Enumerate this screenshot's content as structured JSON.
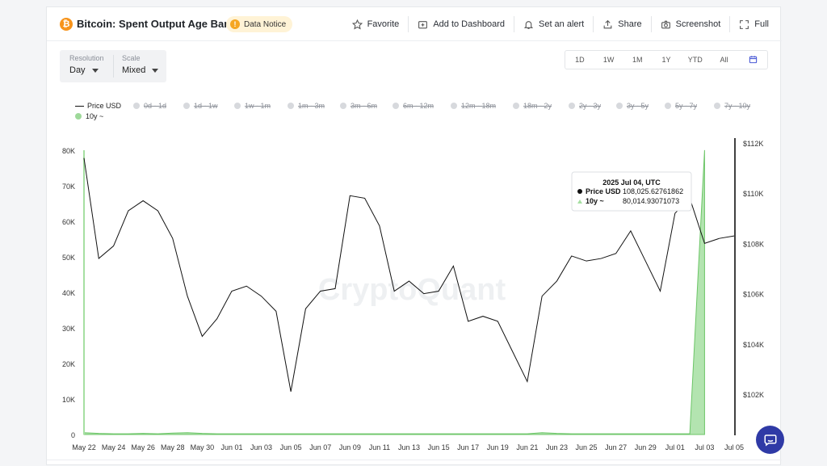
{
  "header": {
    "btc_symbol": "₿",
    "title": "Bitcoin: Spent Output Age Bands",
    "notice": "Data Notice",
    "actions": [
      {
        "label": "Favorite",
        "icon": "star-icon"
      },
      {
        "label": "Add to Dashboard",
        "icon": "dashboard-add-icon"
      },
      {
        "label": "Set an alert",
        "icon": "bell-icon"
      },
      {
        "label": "Share",
        "icon": "share-icon"
      },
      {
        "label": "Screenshot",
        "icon": "camera-icon"
      },
      {
        "label": "Full",
        "icon": "fullscreen-icon"
      }
    ]
  },
  "controls": {
    "resolution_label": "Resolution",
    "resolution_value": "Day",
    "scale_label": "Scale",
    "scale_value": "Mixed",
    "ranges": [
      "1D",
      "1W",
      "1M",
      "1Y",
      "YTD",
      "All"
    ]
  },
  "legend": [
    {
      "label": "Price USD",
      "active": true,
      "kind": "line"
    },
    {
      "label": "0d - 1d",
      "active": false
    },
    {
      "label": "1d - 1w",
      "active": false
    },
    {
      "label": "1w - 1m",
      "active": false
    },
    {
      "label": "1m - 3m",
      "active": false
    },
    {
      "label": "3m - 6m",
      "active": false
    },
    {
      "label": "6m - 12m",
      "active": false
    },
    {
      "label": "12m - 18m",
      "active": false
    },
    {
      "label": "18m - 2y",
      "active": false
    },
    {
      "label": "2y - 3y",
      "active": false
    },
    {
      "label": "3y - 5y",
      "active": false
    },
    {
      "label": "5y - 7y",
      "active": false
    },
    {
      "label": "7y - 10y",
      "active": false
    },
    {
      "label": "10y ~",
      "active": true,
      "kind": "area"
    }
  ],
  "watermark": "CryptoQuant",
  "tooltip": {
    "date": "2025 Jul 04, UTC",
    "price_label": "Price USD",
    "price_value": "108,025.62761862",
    "band_label": "10y ~",
    "band_value": "80,014.93071073"
  },
  "colors": {
    "price_line": "#111111",
    "band_fill": "#a6dfa2",
    "band_stroke": "#6cc567",
    "accent": "#2f3aa6",
    "bitcoin": "#f7931a"
  },
  "chart_data": {
    "type": "line",
    "x": [
      "May 22",
      "May 23",
      "May 24",
      "May 25",
      "May 26",
      "May 27",
      "May 28",
      "May 29",
      "May 30",
      "May 31",
      "Jun 01",
      "Jun 02",
      "Jun 03",
      "Jun 04",
      "Jun 05",
      "Jun 06",
      "Jun 07",
      "Jun 08",
      "Jun 09",
      "Jun 10",
      "Jun 11",
      "Jun 12",
      "Jun 13",
      "Jun 14",
      "Jun 15",
      "Jun 16",
      "Jun 17",
      "Jun 18",
      "Jun 19",
      "Jun 20",
      "Jun 21",
      "Jun 22",
      "Jun 23",
      "Jun 24",
      "Jun 25",
      "Jun 26",
      "Jun 27",
      "Jun 28",
      "Jun 29",
      "Jun 30",
      "Jul 01",
      "Jul 02",
      "Jul 03",
      "Jul 04",
      "Jul 05"
    ],
    "x_tick_labels": [
      "May 22",
      "May 24",
      "May 26",
      "May 28",
      "May 30",
      "Jun 01",
      "Jun 03",
      "Jun 05",
      "Jun 07",
      "Jun 09",
      "Jun 11",
      "Jun 13",
      "Jun 15",
      "Jun 17",
      "Jun 19",
      "Jun 21",
      "Jun 23",
      "Jun 25",
      "Jun 27",
      "Jun 29",
      "Jul 01",
      "Jul 03",
      "Jul 05"
    ],
    "series": [
      {
        "name": "Price USD",
        "axis": "right",
        "values": [
          111400,
          107400,
          107900,
          109300,
          109700,
          109300,
          108200,
          105900,
          104300,
          105000,
          106100,
          106300,
          105900,
          105300,
          102100,
          105400,
          106100,
          106200,
          109900,
          109800,
          108700,
          106100,
          106500,
          106000,
          106100,
          107100,
          104900,
          105100,
          104900,
          103700,
          102500,
          105900,
          106500,
          107500,
          107300,
          107400,
          107600,
          108500,
          107300,
          106100,
          109200,
          109800,
          108000,
          108200,
          null
        ],
        "last_value": 108300
      },
      {
        "name": "10y ~",
        "axis": "left",
        "values": [
          500,
          300,
          200,
          200,
          300,
          200,
          400,
          500,
          300,
          200,
          200,
          200,
          200,
          200,
          200,
          200,
          200,
          200,
          200,
          200,
          200,
          200,
          200,
          200,
          200,
          200,
          200,
          200,
          200,
          200,
          200,
          500,
          300,
          200,
          200,
          200,
          200,
          200,
          200,
          200,
          200,
          200,
          80014.93,
          null,
          null
        ]
      }
    ],
    "y_left": {
      "ticks": [
        "0",
        "10K",
        "20K",
        "30K",
        "40K",
        "50K",
        "60K",
        "70K",
        "80K"
      ],
      "range": [
        0,
        80000
      ]
    },
    "y_right": {
      "ticks": [
        "$102K",
        "$104K",
        "$106K",
        "$108K",
        "$110K",
        "$112K"
      ],
      "range": [
        101500,
        112000
      ]
    }
  },
  "ui": {
    "chat_icon": "chat-icon"
  }
}
